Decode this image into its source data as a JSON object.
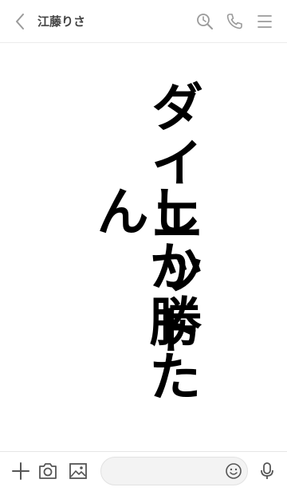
{
  "header": {
    "title": "江藤りさ",
    "icons": [
      "back-chevron-icon",
      "search-icon",
      "phone-icon",
      "menu-icon"
    ]
  },
  "message": {
    "column1": "ダイエット",
    "column2": "しか勝たん"
  },
  "footer": {
    "icons": [
      "plus-icon",
      "camera-icon",
      "image-icon",
      "emoji-icon",
      "microphone-icon"
    ],
    "input_placeholder": ""
  },
  "colors": {
    "icon": "#9a9a9a",
    "text": "#000000",
    "background": "#ffffff"
  }
}
